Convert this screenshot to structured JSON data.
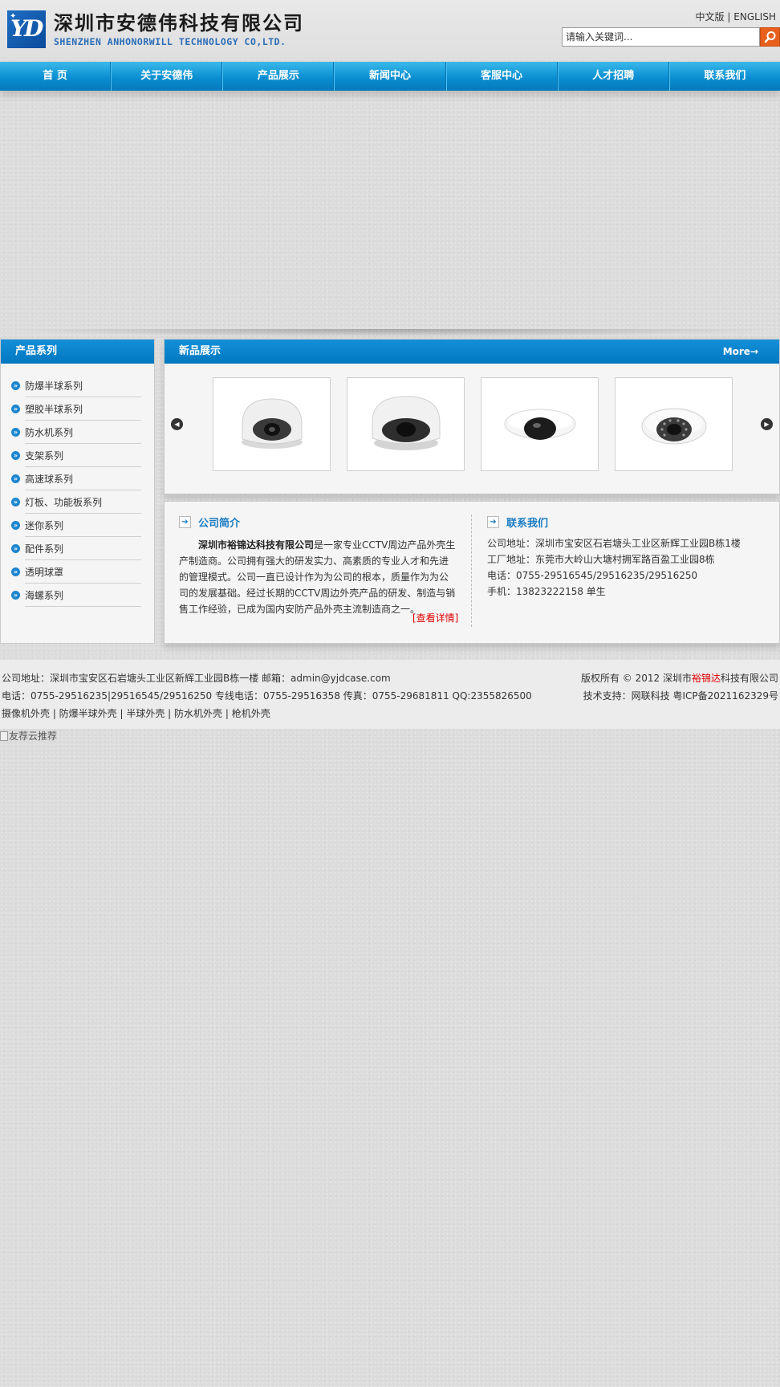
{
  "header": {
    "company_cn": "深圳市安德伟科技有限公司",
    "company_en": "SHENZHEN ANHONORWILL TECHNOLOGY  CO,LTD.",
    "lang_cn": "中文版",
    "lang_sep": "|",
    "lang_en": "ENGLISH",
    "search_placeholder": "请输入关键词..."
  },
  "nav": {
    "items": [
      "首 页",
      "关于安德伟",
      "产品展示",
      "新闻中心",
      "客服中心",
      "人才招聘",
      "联系我们"
    ]
  },
  "sidebar": {
    "title": "产品系列",
    "items": [
      "防爆半球系列",
      "塑胶半球系列",
      "防水机系列",
      "支架系列",
      "高速球系列",
      "灯板、功能板系列",
      "迷你系列",
      "配件系列",
      "透明球罩",
      "海螺系列"
    ]
  },
  "new_products": {
    "title": "新品展示",
    "more": "More→"
  },
  "about": {
    "title": "公司简介",
    "company_bold": "深圳市裕锦达科技有限公司",
    "text": "是一家专业CCTV周边产品外壳生产制造商。公司拥有强大的研发实力、高素质的专业人才和先进的管理模式。公司一直已设计作为为公司的根本，质量作为为公司的发展基础。经过长期的CCTV周边外壳产品的研发、制造与销售工作经验，已成为国内安防产品外壳主流制造商之一。",
    "detail": "[查看详情]"
  },
  "contact": {
    "title": "联系我们",
    "lines": [
      "公司地址：深圳市宝安区石岩塘头工业区新辉工业园B栋1楼",
      "工厂地址：东莞市大岭山大塘村拥军路百盈工业园8栋",
      "电话：0755-29516545/29516235/29516250",
      "手机：13823222158  单生"
    ]
  },
  "footer": {
    "left": [
      "公司地址：深圳市宝安区石岩塘头工业区新辉工业园B栋一楼  邮箱：admin@yjdcase.com",
      "电话：0755-29516235|29516545/29516250   专线电话：0755-29516358  传真：0755-29681811  QQ:2355826500",
      "摄像机外壳  |  防爆半球外壳  |  半球外壳  |  防水机外壳  |  枪机外壳"
    ],
    "copyright_prefix": "版权所有 © 2012 深圳市",
    "copyright_red": "裕锦达",
    "copyright_suffix": "科技有限公司",
    "support": "技术支持：网联科技 粤ICP备2021162329号"
  },
  "friend_alt": "友荐云推荐",
  "colors": {
    "nav_blue": "#0a8fd2",
    "title_blue": "#1a7cc3",
    "search_orange": "#e8601c",
    "link_red": "#e00000"
  }
}
